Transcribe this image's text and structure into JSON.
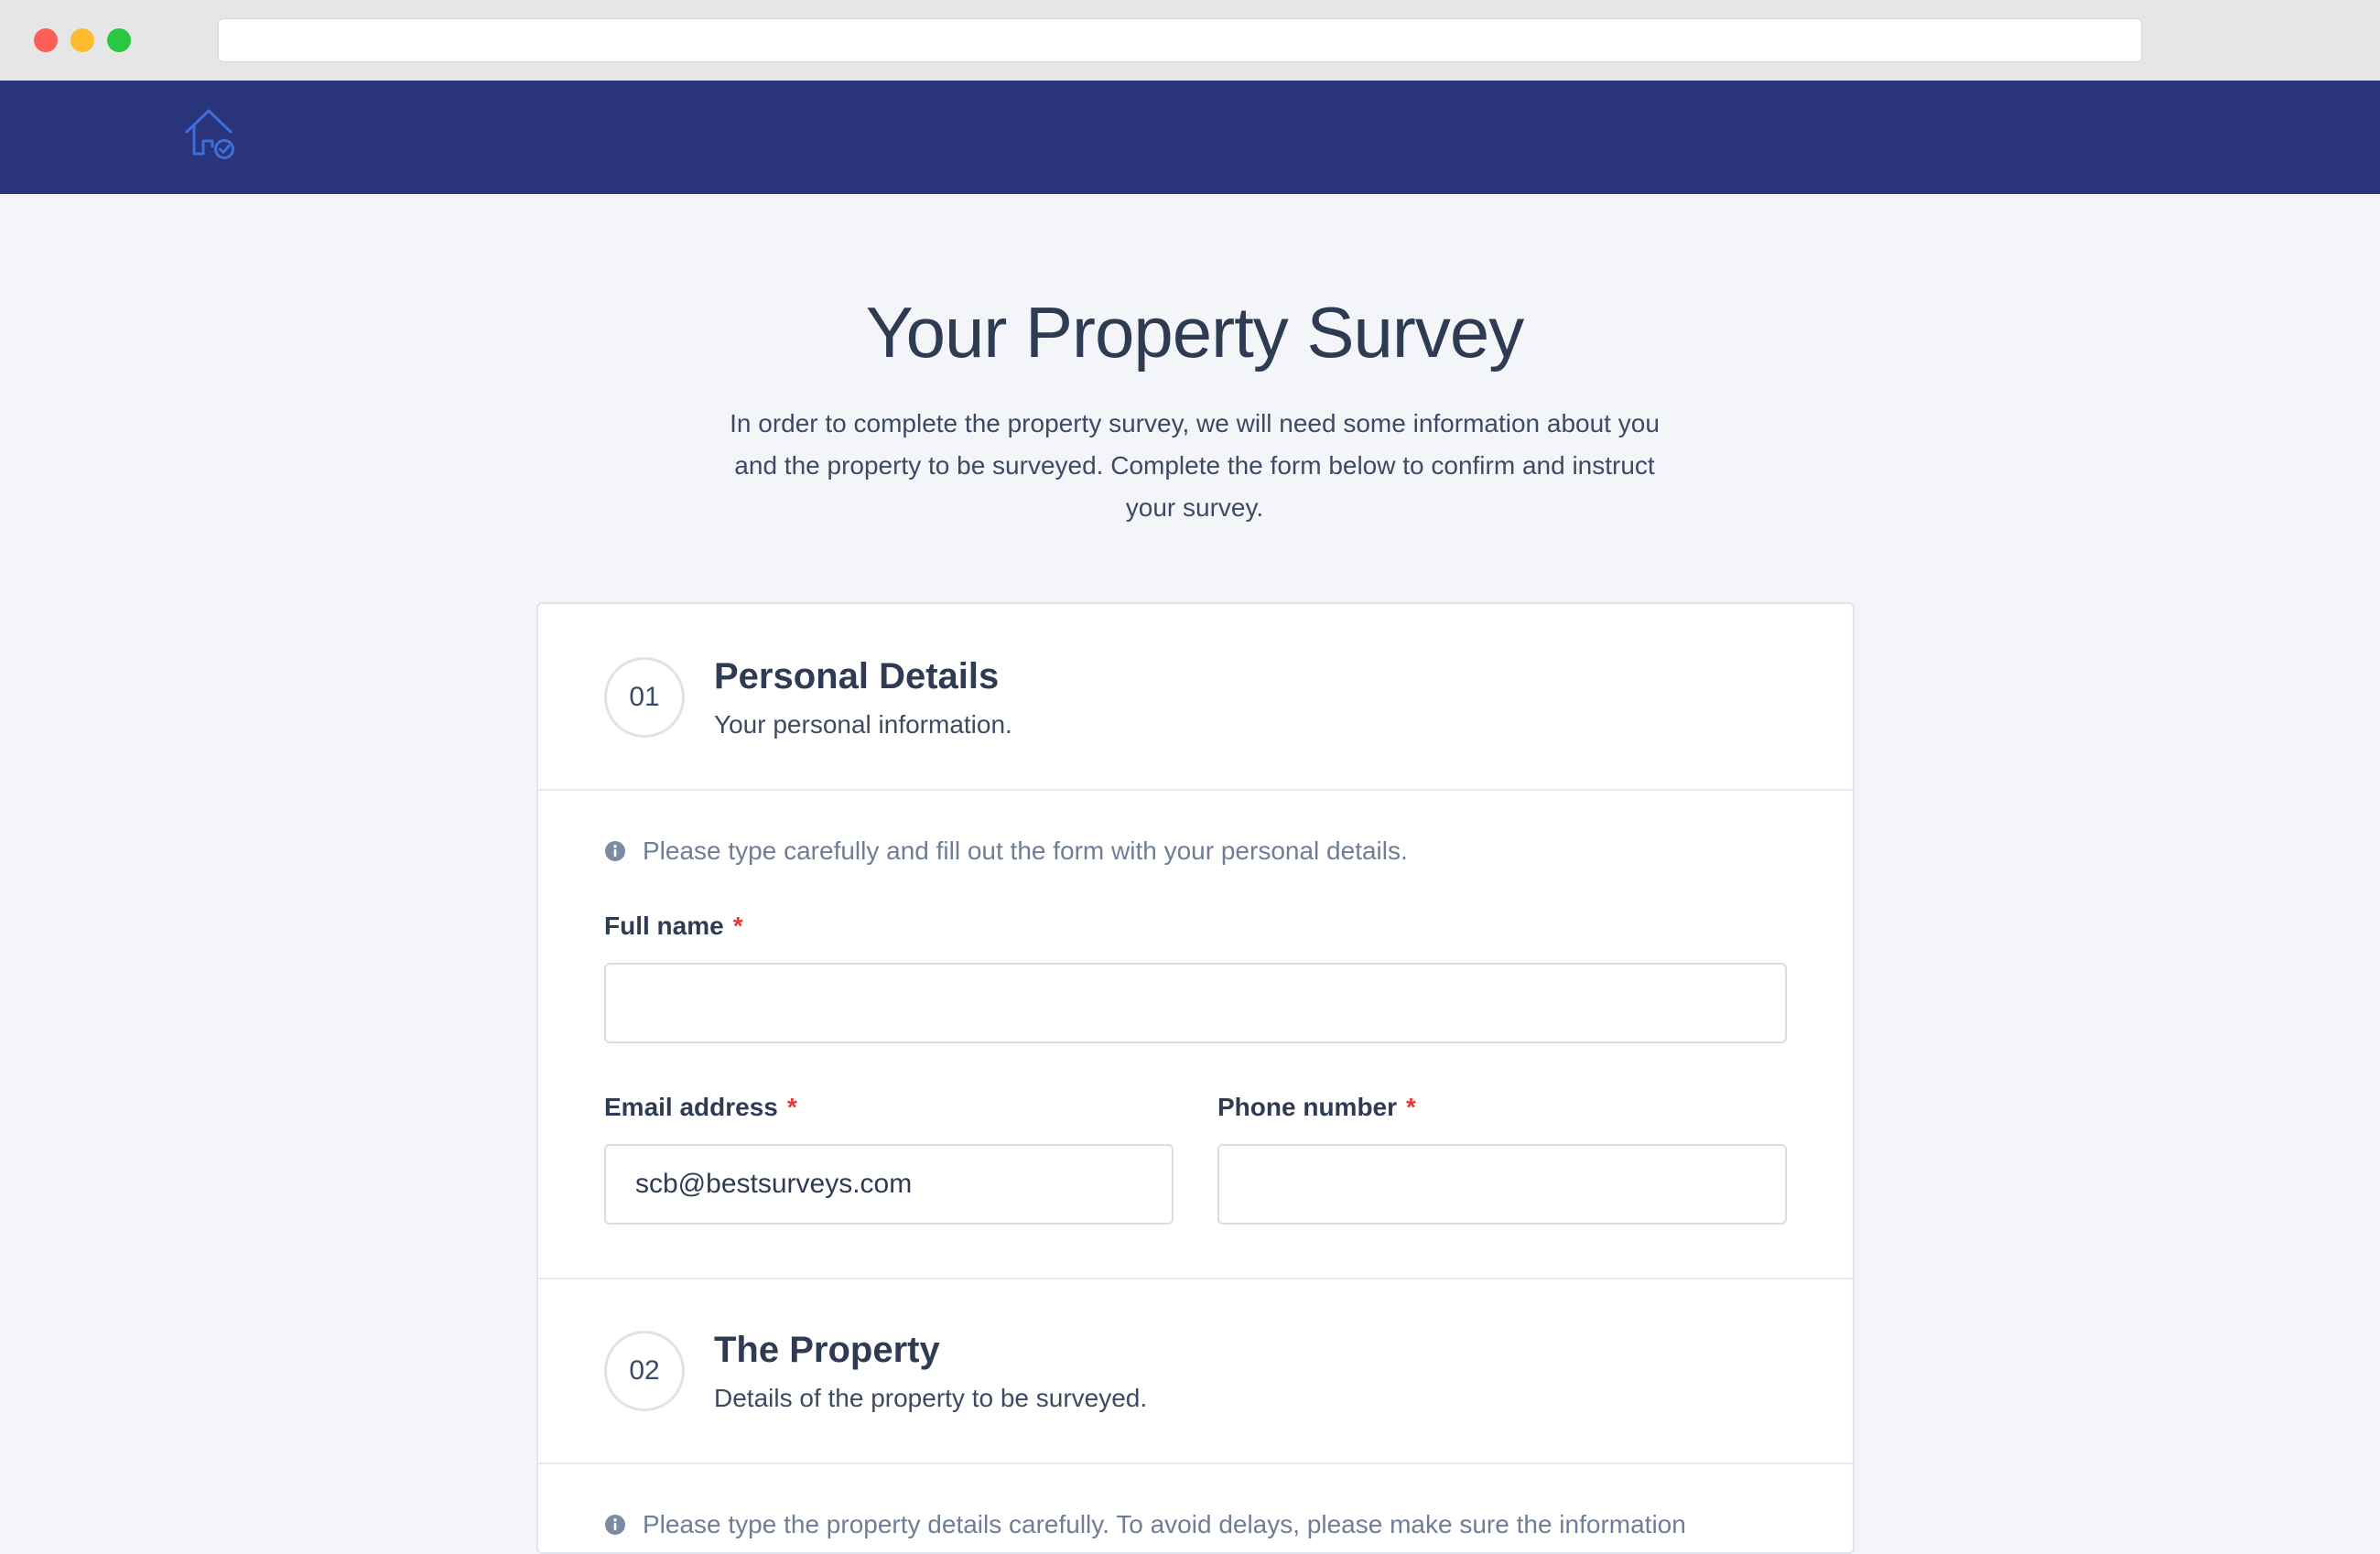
{
  "browser": {
    "address": ""
  },
  "header": {
    "logo_icon": "house-check-icon",
    "background": "#2a347a"
  },
  "page": {
    "title": "Your Property Survey",
    "intro": "In order to complete the property survey, we will need some information about you and the property to be surveyed. Complete the form below to confirm and instruct your survey."
  },
  "sections": [
    {
      "number": "01",
      "title": "Personal Details",
      "subtitle": "Your personal information.",
      "note": "Please type carefully and fill out the form with your personal details.",
      "fields": {
        "full_name": {
          "label": "Full name",
          "required": "*",
          "value": ""
        },
        "email": {
          "label": "Email address",
          "required": "*",
          "value": "scb@bestsurveys.com"
        },
        "phone": {
          "label": "Phone number",
          "required": "*",
          "value": ""
        }
      }
    },
    {
      "number": "02",
      "title": "The Property",
      "subtitle": "Details of the property to be surveyed.",
      "note": "Please type the property details carefully. To avoid delays, please make sure the information"
    }
  ],
  "colors": {
    "accent": "#3d6fd8",
    "required": "#e53935",
    "page_background": "#f4f5f9"
  }
}
